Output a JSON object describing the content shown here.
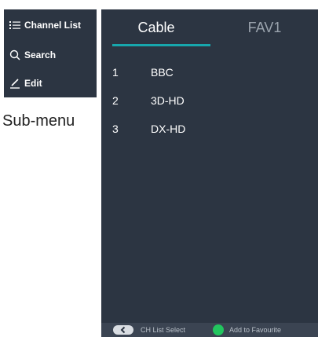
{
  "submenu": {
    "items": [
      {
        "label": "Channel List",
        "icon": "list-icon"
      },
      {
        "label": "Search",
        "icon": "search-icon"
      },
      {
        "label": "Edit",
        "icon": "pencil-icon"
      }
    ],
    "caption": "Sub-menu"
  },
  "tabs": [
    {
      "label": "Cable",
      "active": true
    },
    {
      "label": "FAV1",
      "active": false
    }
  ],
  "channels": [
    {
      "number": "1",
      "name": "BBC"
    },
    {
      "number": "2",
      "name": "3D-HD"
    },
    {
      "number": "3",
      "name": "DX-HD"
    }
  ],
  "footer": {
    "back_hint": "CH List Select",
    "green_hint": "Add to Favourite"
  },
  "colors": {
    "panel_bg": "#2c3542",
    "accent": "#17a7ad",
    "green_key": "#22c55e"
  }
}
